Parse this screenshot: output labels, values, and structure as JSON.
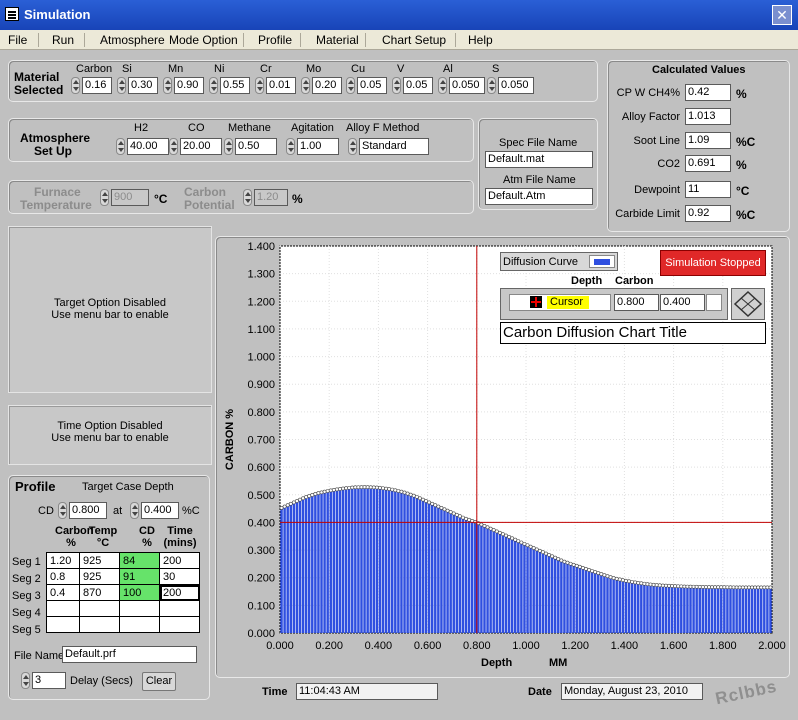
{
  "window": {
    "title": "Simulation",
    "close": "✕"
  },
  "menu": [
    "File",
    "Run",
    "Atmosphere",
    "Mode Option",
    "Profile",
    "Material",
    "Chart Setup",
    "Help"
  ],
  "material": {
    "label1": "Material",
    "label2": "Selected",
    "elements": [
      {
        "name": "Carbon",
        "value": "0.16"
      },
      {
        "name": "Si",
        "value": "0.30"
      },
      {
        "name": "Mn",
        "value": "0.90"
      },
      {
        "name": "Ni",
        "value": "0.55"
      },
      {
        "name": "Cr",
        "value": "0.01"
      },
      {
        "name": "Mo",
        "value": "0.20"
      },
      {
        "name": "Cu",
        "value": "0.05"
      },
      {
        "name": "V",
        "value": "0.05"
      },
      {
        "name": "Al",
        "value": "0.050"
      },
      {
        "name": "S",
        "value": "0.050"
      }
    ]
  },
  "atmosphere": {
    "label1": "Atmosphere",
    "label2": "Set Up",
    "fields": [
      {
        "name": "H2",
        "value": "40.00"
      },
      {
        "name": "CO",
        "value": "20.00"
      },
      {
        "name": "Methane",
        "value": "0.50"
      },
      {
        "name": "Agitation",
        "value": "1.00"
      },
      {
        "name": "Alloy F Method",
        "value": "Standard"
      }
    ]
  },
  "files": {
    "spec_label": "Spec File Name",
    "spec_value": "Default.mat",
    "atm_label": "Atm File Name",
    "atm_value": "Default.Atm"
  },
  "furnace": {
    "label1": "Furnace",
    "label2": "Temperature",
    "value": "900",
    "unit": "°C",
    "cp_label1": "Carbon",
    "cp_label2": "Potential",
    "cp_value": "1.20",
    "cp_unit": "%"
  },
  "calculated": {
    "title": "Calculated Values",
    "rows": [
      {
        "label": "CP W CH4%",
        "value": "0.42",
        "unit": "%"
      },
      {
        "label": "Alloy Factor",
        "value": "1.013",
        "unit": ""
      },
      {
        "label": "Soot Line",
        "value": "1.09",
        "unit": "%C"
      },
      {
        "label": "CO2",
        "value": "0.691",
        "unit": "%"
      },
      {
        "label": "Dewpoint",
        "value": "11",
        "unit": "°C"
      },
      {
        "label": "Carbide Limit",
        "value": "0.92",
        "unit": "%C"
      }
    ]
  },
  "target_option": {
    "line1": "Target Option Disabled",
    "line2": "Use menu bar to enable"
  },
  "time_option": {
    "line1": "Time Option Disabled",
    "line2": "Use menu bar to enable"
  },
  "profile": {
    "title": "Profile",
    "target_label": "Target Case Depth",
    "cd_label": "CD",
    "cd_value": "0.800",
    "at_label": "at",
    "at_value": "0.400",
    "at_unit": "%C",
    "headers": [
      [
        "Carbon",
        "%"
      ],
      [
        "Temp",
        "°C"
      ],
      [
        "CD",
        "%"
      ],
      [
        "Time",
        "(mins)"
      ]
    ],
    "segments": [
      {
        "label": "Seg 1",
        "carbon": "1.20",
        "temp": "925",
        "cd": "84",
        "time": "200"
      },
      {
        "label": "Seg 2",
        "carbon": "0.8",
        "temp": "925",
        "cd": "91",
        "time": "30"
      },
      {
        "label": "Seg 3",
        "carbon": "0.4",
        "temp": "870",
        "cd": "100",
        "time": "200"
      },
      {
        "label": "Seg 4",
        "carbon": "",
        "temp": "",
        "cd": "",
        "time": ""
      },
      {
        "label": "Seg 5",
        "carbon": "",
        "temp": "",
        "cd": "",
        "time": ""
      }
    ],
    "file_label": "File Name",
    "file_value": "Default.prf",
    "delay_value": "3",
    "delay_label": "Delay (Secs)",
    "clear": "Clear"
  },
  "chart_controls": {
    "diffusion_curve": "Diffusion Curve",
    "status": "Simulation Stopped",
    "depth_label": "Depth",
    "carbon_label": "Carbon",
    "cursor_label": "Cursor",
    "cursor_depth": "0.800",
    "cursor_carbon": "0.400",
    "chart_title": "Carbon Diffusion Chart Title"
  },
  "footer": {
    "time_label": "Time",
    "time_value": "11:04:43 AM",
    "date_label": "Date",
    "date_value": "Monday, August 23, 2010",
    "watermark": "Rclbbs"
  },
  "chart_data": {
    "type": "bar",
    "title": "Carbon Diffusion Chart Title",
    "xlabel": "Depth",
    "xunit": "MM",
    "ylabel": "CARBON %",
    "xlim": [
      0,
      2.0
    ],
    "ylim": [
      0,
      1.4
    ],
    "xticks": [
      "0.000",
      "0.200",
      "0.400",
      "0.600",
      "0.800",
      "1.000",
      "1.200",
      "1.400",
      "1.600",
      "1.800",
      "2.000"
    ],
    "yticks": [
      "0.000",
      "0.100",
      "0.200",
      "0.300",
      "0.400",
      "0.500",
      "0.600",
      "0.700",
      "0.800",
      "0.900",
      "1.000",
      "1.100",
      "1.200",
      "1.300",
      "1.400"
    ],
    "cursor": {
      "x": 0.8,
      "y": 0.4
    },
    "bar_color": "#2f4fe0",
    "cursor_color": "#c00000",
    "x": [
      0.0,
      0.05,
      0.1,
      0.15,
      0.2,
      0.25,
      0.3,
      0.35,
      0.4,
      0.45,
      0.5,
      0.55,
      0.6,
      0.65,
      0.7,
      0.75,
      0.8,
      0.85,
      0.9,
      0.95,
      1.0,
      1.05,
      1.1,
      1.15,
      1.2,
      1.25,
      1.3,
      1.35,
      1.4,
      1.45,
      1.5,
      1.55,
      1.6,
      1.65,
      1.7,
      1.75,
      1.8,
      1.85,
      1.9,
      1.95,
      2.0
    ],
    "values": [
      0.45,
      0.47,
      0.49,
      0.505,
      0.515,
      0.522,
      0.527,
      0.528,
      0.526,
      0.52,
      0.51,
      0.495,
      0.475,
      0.455,
      0.435,
      0.415,
      0.4,
      0.38,
      0.36,
      0.34,
      0.32,
      0.3,
      0.28,
      0.26,
      0.245,
      0.23,
      0.215,
      0.2,
      0.19,
      0.182,
      0.176,
      0.172,
      0.17,
      0.168,
      0.167,
      0.166,
      0.166,
      0.165,
      0.165,
      0.165,
      0.165
    ]
  }
}
